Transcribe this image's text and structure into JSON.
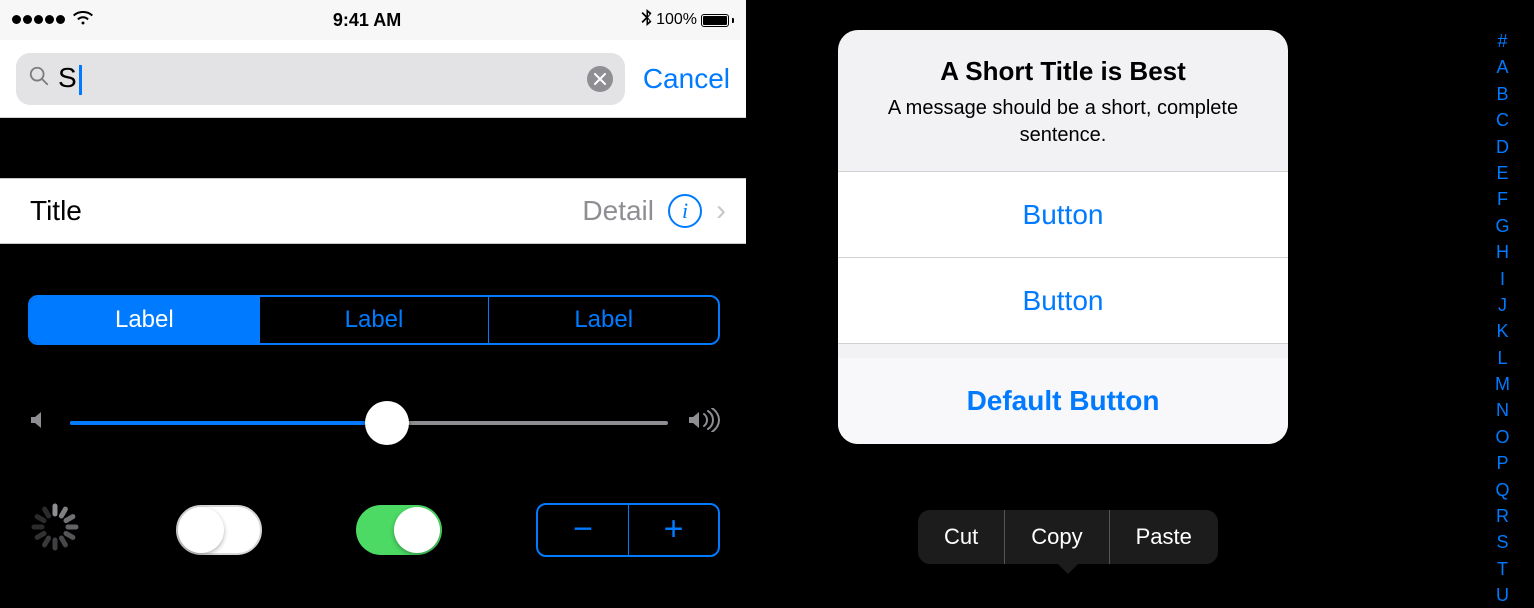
{
  "status": {
    "time": "9:41 AM",
    "battery": "100%"
  },
  "search": {
    "query": "S",
    "cancel": "Cancel"
  },
  "cell": {
    "title": "Title",
    "detail": "Detail",
    "info": "i"
  },
  "segmented": {
    "labels": [
      "Label",
      "Label",
      "Label"
    ]
  },
  "stepper": {
    "minus": "−",
    "plus": "+"
  },
  "sheet": {
    "title": "A Short Title is Best",
    "message": "A message should be a short, complete sentence.",
    "buttons": [
      "Button",
      "Button"
    ],
    "default": "Default Button"
  },
  "editmenu": [
    "Cut",
    "Copy",
    "Paste"
  ],
  "index": [
    "#",
    "A",
    "B",
    "C",
    "D",
    "E",
    "F",
    "G",
    "H",
    "I",
    "J",
    "K",
    "L",
    "M",
    "N",
    "O",
    "P",
    "Q",
    "R",
    "S",
    "T",
    "U"
  ]
}
